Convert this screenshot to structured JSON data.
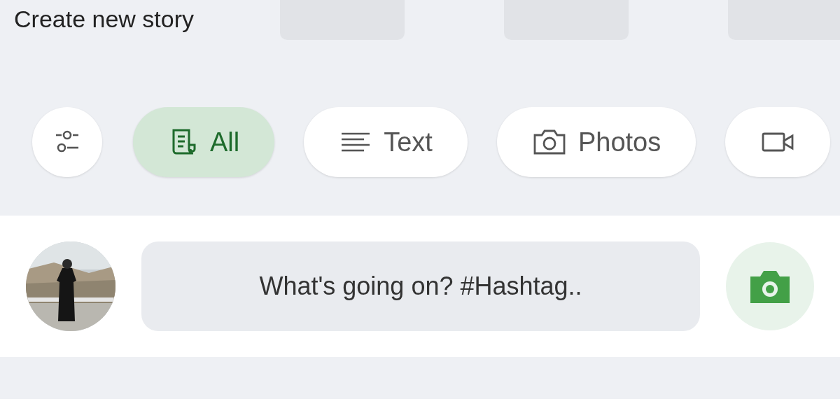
{
  "header": {
    "title": "Create new story"
  },
  "filters": [
    {
      "kind": "all",
      "label": "All",
      "selected": true
    },
    {
      "kind": "text",
      "label": "Text",
      "selected": false
    },
    {
      "kind": "photos",
      "label": "Photos",
      "selected": false
    },
    {
      "kind": "video",
      "selected": false
    }
  ],
  "composer": {
    "placeholder": "What's going on? #Hashtag.."
  }
}
